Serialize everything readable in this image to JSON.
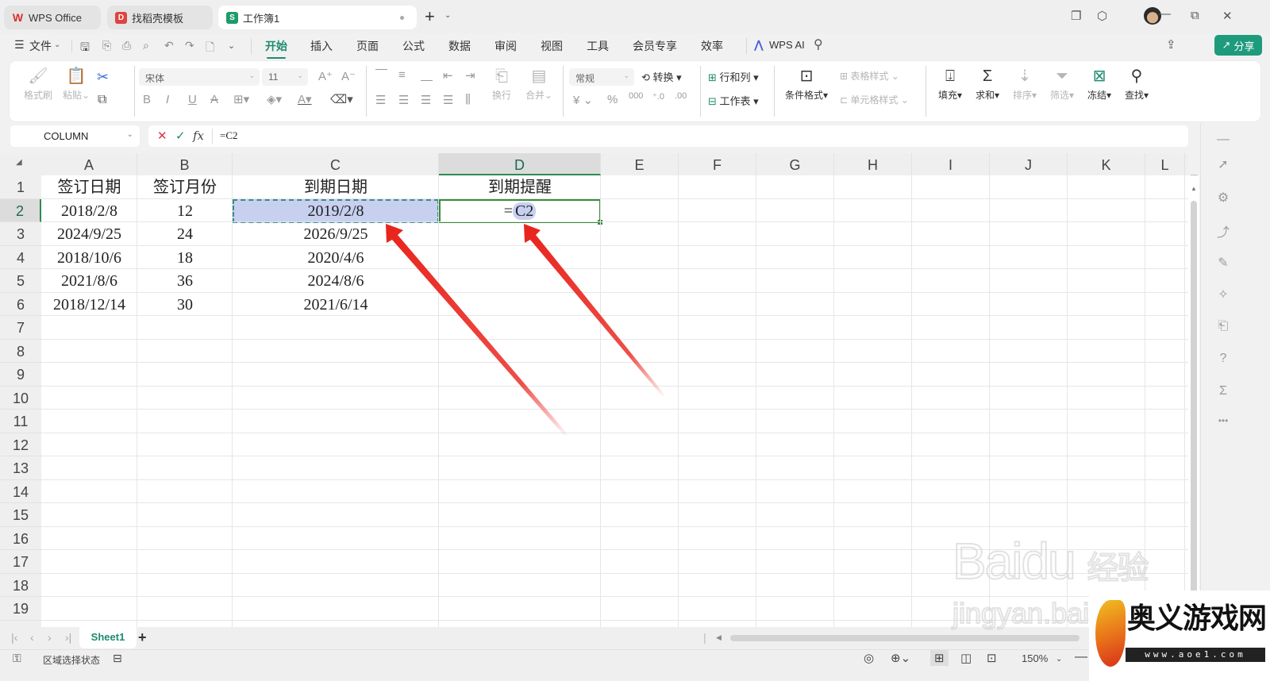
{
  "titlebar": {
    "tabs": [
      {
        "label": "WPS Office",
        "icon": "wps-logo-icon",
        "color": "#d9302c"
      },
      {
        "label": "找稻壳模板",
        "icon": "docer-icon",
        "color": "#e0433f"
      },
      {
        "label": "工作簿1",
        "icon": "spreadsheet-icon",
        "icon_text": "S",
        "color": "#1e9b6b",
        "active": true
      }
    ],
    "new_tab": "+",
    "window_controls": [
      "minimize",
      "restore",
      "close"
    ]
  },
  "menubar": {
    "file_label": "文件",
    "items": [
      "开始",
      "插入",
      "页面",
      "公式",
      "数据",
      "审阅",
      "视图",
      "工具",
      "会员专享",
      "效率"
    ],
    "active": "开始",
    "wps_ai": "WPS AI",
    "share": "分享"
  },
  "ribbon": {
    "format_painter": "格式刷",
    "paste": "粘贴",
    "font_name": "宋体",
    "font_size": "11",
    "wrap": "换行",
    "merge": "合并",
    "number_format": "常规",
    "convert": "转换",
    "rows_cols": "行和列",
    "worksheet": "工作表",
    "cond_format": "条件格式",
    "table_style": "表格样式",
    "cell_style": "单元格样式",
    "fill": "填充",
    "sum": "求和",
    "sort": "排序",
    "filter": "筛选",
    "freeze": "冻结",
    "find": "查找",
    "currency_symbol": "¥",
    "percent_symbol": "%"
  },
  "formula_bar": {
    "name_box": "COLUMN",
    "formula": "=C2"
  },
  "grid": {
    "columns": [
      "A",
      "B",
      "C",
      "D",
      "E",
      "F",
      "G",
      "H",
      "I",
      "J",
      "K",
      "L"
    ],
    "selected_column": "D",
    "rows": [
      "1",
      "2",
      "3",
      "4",
      "5",
      "6",
      "7",
      "8",
      "9",
      "10",
      "11",
      "12",
      "13",
      "14",
      "15",
      "16",
      "17",
      "18",
      "19"
    ],
    "selected_row": "2",
    "cells": {
      "A1": "签订日期",
      "B1": "签订月份",
      "C1": "到期日期",
      "D1": "到期提醒",
      "A2": "2018/2/8",
      "B2": "12",
      "C2": "2019/2/8",
      "A3": "2024/9/25",
      "B3": "24",
      "C3": "2026/9/25",
      "A4": "2018/10/6",
      "B4": "18",
      "C4": "2020/4/6",
      "A5": "2021/8/6",
      "B5": "36",
      "C5": "2024/8/6",
      "A6": "2018/12/14",
      "B6": "30",
      "C6": "2021/6/14"
    },
    "editing_cell": "D2",
    "editing_prefix": "=",
    "editing_ref": "C2",
    "referenced_cell": "C2"
  },
  "sheets": {
    "tabs": [
      "Sheet1"
    ],
    "active": "Sheet1",
    "add": "+"
  },
  "statusbar": {
    "mode": "区域选择状态",
    "zoom": "150%"
  },
  "annotations": {
    "arrow_color": "#e8231b",
    "arrows": [
      "points-to-C2",
      "points-to-D2-reference"
    ]
  },
  "watermarks": {
    "baidu": "Baidu",
    "baidu_cn": "经验",
    "baidu_url": "jingyan.baidu",
    "site_name": "奥义游戏网",
    "site_url": "www.aoe1.com"
  }
}
